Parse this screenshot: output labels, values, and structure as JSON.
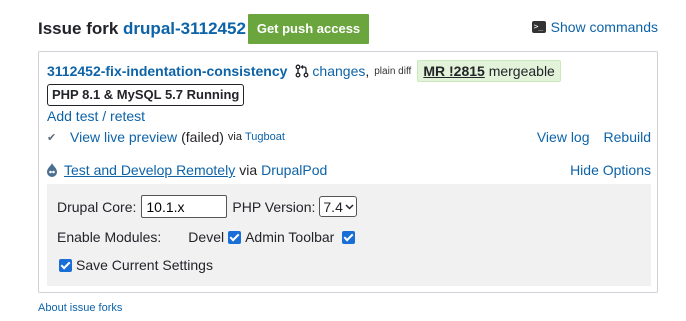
{
  "header": {
    "title_prefix": "Issue fork",
    "fork_name": "drupal-3112452",
    "push_access_label": "Get push access",
    "show_commands_label": "Show commands"
  },
  "merge_request": {
    "branch": "3112452-fix-indentation-consistency",
    "changes_label": "changes",
    "comma": ",",
    "plain_diff_label": "plain diff",
    "mr_label": "MR !2815",
    "mr_status": "mergeable"
  },
  "environment": {
    "badge": "PHP 8.1 & MySQL 5.7 Running"
  },
  "add_test_label": "Add test / retest",
  "preview": {
    "label": "View live preview",
    "status": "(failed)",
    "via": "via",
    "provider": "Tugboat",
    "view_log_label": "View log",
    "rebuild_label": "Rebuild"
  },
  "drupalpod": {
    "link_label": "Test and Develop Remotely",
    "via": "via",
    "provider": "DrupalPod",
    "hide_options_label": "Hide Options"
  },
  "options": {
    "core_label": "Drupal Core:",
    "core_value": "10.1.x",
    "php_label": "PHP Version:",
    "php_value": "7.4",
    "modules_label": "Enable Modules:",
    "modules": [
      {
        "name": "Devel",
        "checked": true
      },
      {
        "name": "Admin Toolbar",
        "checked": true
      }
    ],
    "save_settings_label": "Save Current Settings",
    "save_settings_checked": true
  },
  "footer": {
    "about_label": "About issue forks"
  },
  "colors": {
    "link": "#0d63a8",
    "push_button": "#6aa63d",
    "mergeable_bg": "#e3f3da",
    "checkbox": "#1a6fd6",
    "options_bg": "#f1f1f2"
  }
}
